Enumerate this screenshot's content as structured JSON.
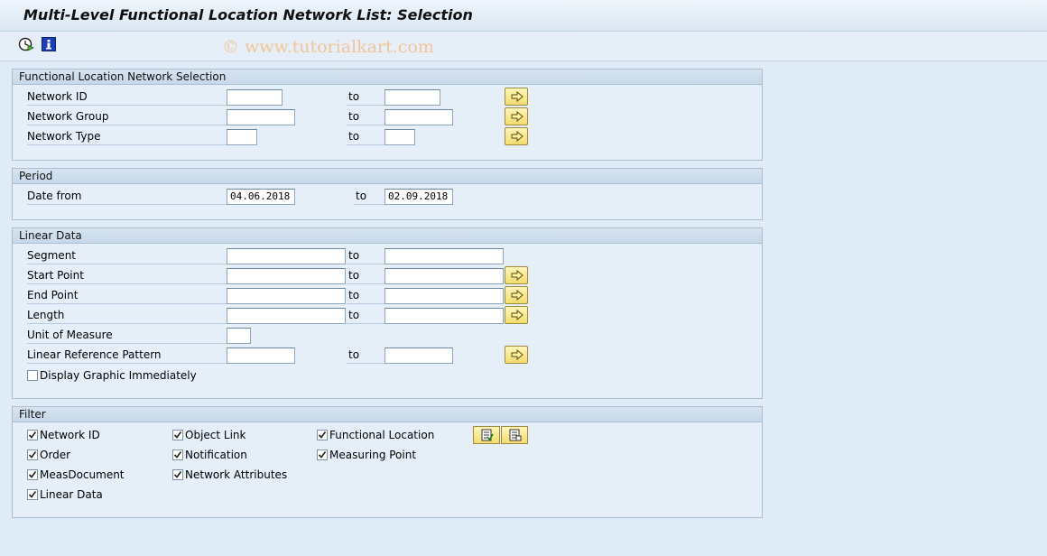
{
  "window": {
    "title": "Multi-Level Functional Location Network List: Selection"
  },
  "toolbar": {
    "execute_icon": "execute-clock-icon",
    "info_icon": "info-icon"
  },
  "watermark": "© www.tutorialkart.com",
  "to_label": "to",
  "groups": {
    "network": {
      "title": "Functional Location Network Selection",
      "rows": [
        {
          "label": "Network ID",
          "from": "",
          "to": ""
        },
        {
          "label": "Network Group",
          "from": "",
          "to": ""
        },
        {
          "label": "Network Type",
          "from": "",
          "to": ""
        }
      ]
    },
    "period": {
      "title": "Period",
      "rows": [
        {
          "label": "Date from",
          "from": "04.06.2018",
          "to": "02.09.2018"
        }
      ]
    },
    "linear": {
      "title": "Linear Data",
      "rows": [
        {
          "label": "Segment",
          "from": "",
          "to": ""
        },
        {
          "label": "Start Point",
          "from": "",
          "to": ""
        },
        {
          "label": "End Point",
          "from": "",
          "to": ""
        },
        {
          "label": "Length",
          "from": "",
          "to": ""
        },
        {
          "label": "Unit of Measure",
          "from": ""
        },
        {
          "label": "Linear Reference Pattern",
          "from": "",
          "to": ""
        }
      ],
      "display_graphic": {
        "label": "Display Graphic Immediately",
        "checked": false
      }
    },
    "filter": {
      "title": "Filter",
      "items": [
        {
          "label": "Network ID",
          "checked": true
        },
        {
          "label": "Object Link",
          "checked": true
        },
        {
          "label": "Functional Location",
          "checked": true
        },
        {
          "label": "Order",
          "checked": true
        },
        {
          "label": "Notification",
          "checked": true
        },
        {
          "label": "Measuring Point",
          "checked": true
        },
        {
          "label": "MeasDocument",
          "checked": true
        },
        {
          "label": "Network Attributes",
          "checked": true
        },
        {
          "label": "Linear Data",
          "checked": true
        }
      ]
    }
  },
  "colors": {
    "background": "#dfebf5",
    "group_bg": "#e6eff8",
    "button_yellow": "#f3dc6e",
    "watermark": "#f2c59a"
  }
}
